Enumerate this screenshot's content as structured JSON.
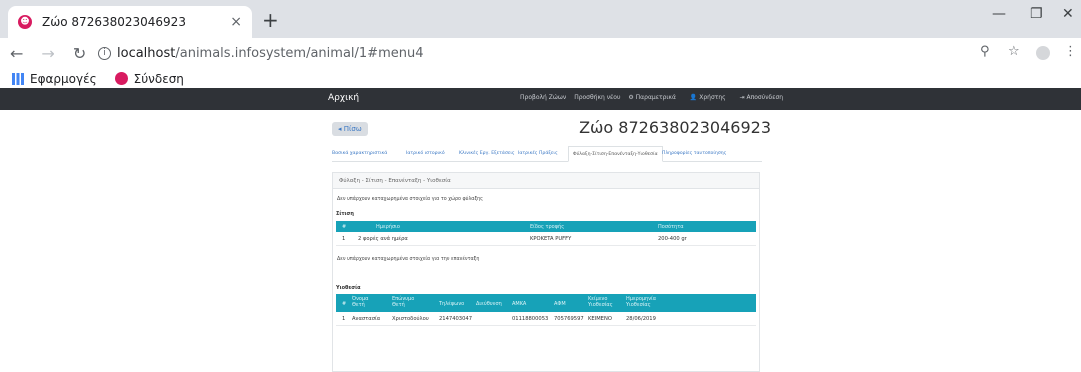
{
  "browser": {
    "tab_title": "Ζώο 872638023046923",
    "tab_close": "×",
    "new_tab": "+",
    "url_host": "localhost",
    "url_path": "/animals.infosystem/animal/1#menu4",
    "bookmarks": [
      "Εφαρμογές",
      "Σύνδεση"
    ]
  },
  "nav": {
    "brand": "Αρχική",
    "links": [
      "Προβολή Ζώων",
      "Προσθήκη νέου",
      "Παραμετρικά",
      "Χρήστης",
      "Αποσύνδεση"
    ]
  },
  "page": {
    "back_label": "Πίσω",
    "title": "Ζώο 872638023046923",
    "tabs": [
      "Βασικά χαρακτηριστικά",
      "Ιατρικό ιστορικό",
      "Κλινικές Εργ. Εξετάσεις",
      "Ιατρικές Πράξεις",
      "Φύλαξη-Σίτιση-Επανένταξη-Υιοθεσία",
      "Πληροφορίες ταυτοποίησης"
    ],
    "active_tab": 4,
    "panel_title": "Φύλαξη - Σίτιση - Επανένταξη - Υιοθεσία",
    "no_custody": "Δεν υπάρχουν καταχωρημένα στοιχεία για το χώρο φύλαξης",
    "feeding": {
      "title": "Σίτιση",
      "headers": [
        "#",
        "Ημερήσιο",
        "Είδος τροφής",
        "Ποσότητα"
      ],
      "rows": [
        [
          "1",
          "2 φορές ανά ημέρα",
          "KPOKETA PUFFY",
          "200-400 gr"
        ]
      ]
    },
    "no_reintegration": "Δεν υπάρχουν καταχωρημένα στοιχεία για την επανένταξη",
    "adoption": {
      "title": "Υιοθεσία",
      "headers": [
        "#",
        "Όνομα Θετή",
        "Επώνυμο Θετή",
        "Τηλέφωνο",
        "Διεύθυνση",
        "AMKA",
        "ΑΦΜ",
        "Κείμενο Υιοθεσίας",
        "Ημερομηνία Υιοθεσίας"
      ],
      "rows": [
        [
          "1",
          "Αναστασία",
          "Χριστοδούλου",
          "2147403047",
          "",
          "01118800053",
          "705769597",
          "KEIMENO",
          "28/06/2019"
        ]
      ]
    }
  }
}
